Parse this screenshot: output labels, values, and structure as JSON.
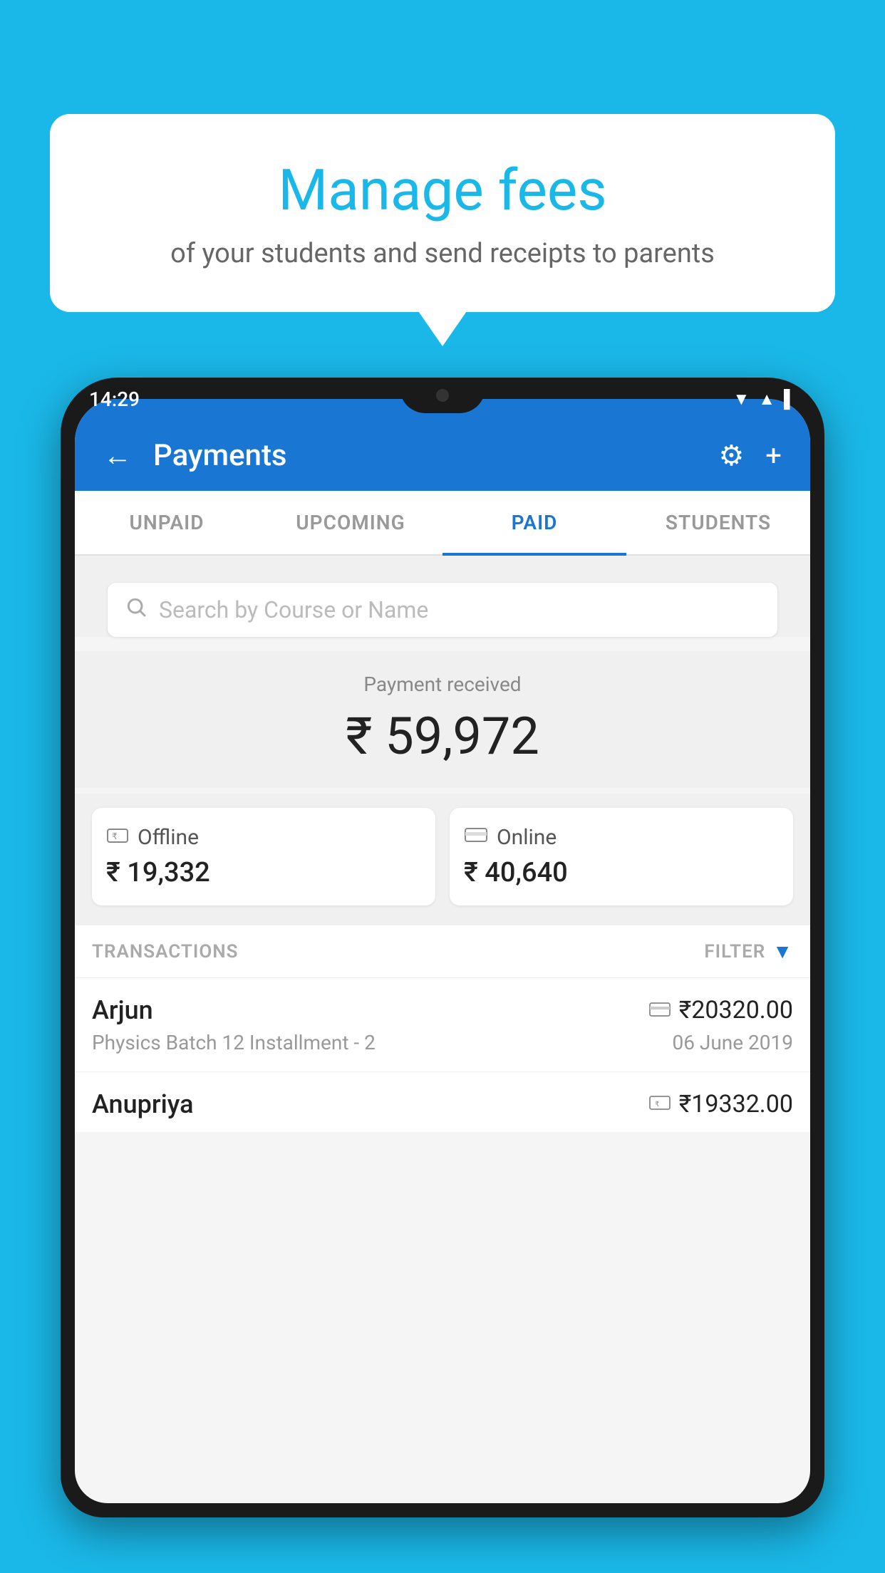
{
  "background_color": "#1ab8e8",
  "speech_bubble": {
    "title": "Manage fees",
    "subtitle": "of your students and send receipts to parents"
  },
  "phone": {
    "status_bar": {
      "time": "14:29",
      "signal_icons": "▼▲▌"
    },
    "header": {
      "back_label": "←",
      "title": "Payments",
      "gear_icon": "⚙",
      "add_icon": "+"
    },
    "tabs": [
      {
        "label": "UNPAID",
        "active": false
      },
      {
        "label": "UPCOMING",
        "active": false
      },
      {
        "label": "PAID",
        "active": true
      },
      {
        "label": "STUDENTS",
        "active": false
      }
    ],
    "search": {
      "placeholder": "Search by Course or Name"
    },
    "payment_summary": {
      "label": "Payment received",
      "amount": "₹ 59,972",
      "offline_label": "Offline",
      "offline_amount": "₹ 19,332",
      "online_label": "Online",
      "online_amount": "₹ 40,640"
    },
    "transactions": {
      "header_label": "TRANSACTIONS",
      "filter_label": "FILTER",
      "rows": [
        {
          "name": "Arjun",
          "amount": "₹20320.00",
          "course": "Physics Batch 12 Installment - 2",
          "date": "06 June 2019",
          "type": "online"
        },
        {
          "name": "Anupriya",
          "amount": "₹19332.00",
          "course": "",
          "date": "",
          "type": "offline"
        }
      ]
    }
  }
}
